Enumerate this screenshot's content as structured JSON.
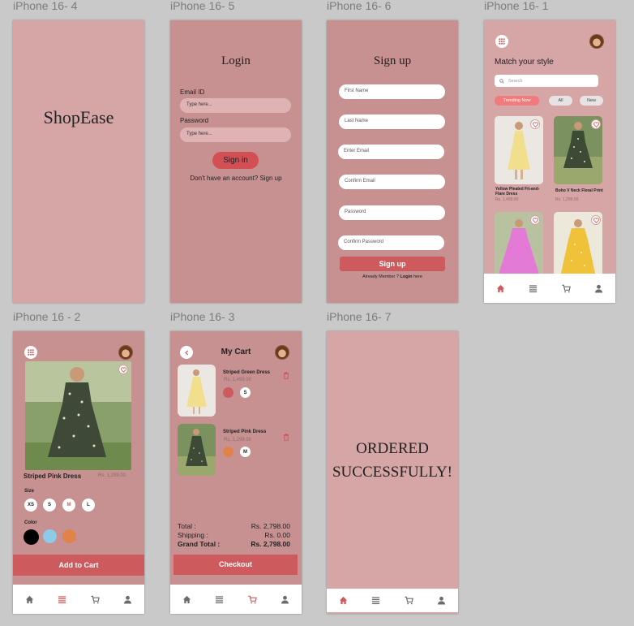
{
  "frames": {
    "f4": {
      "label": "iPhone 16- 4",
      "brand": "ShopEase"
    },
    "f5": {
      "label": "iPhone 16- 5",
      "title": "Login",
      "email_label": "Email ID",
      "email_placeholder": "Type here...",
      "password_label": "Password",
      "password_placeholder": "Type here...",
      "signin": "Sign in",
      "signup_prompt": "Don't have an account? Sign up"
    },
    "f6": {
      "label": "iPhone 16- 6",
      "title": "Sign up",
      "fields": [
        "First Name",
        "Last Name",
        "Enter Email",
        "Confirm Email",
        "Password",
        "Confirm Password"
      ],
      "signup_button": "Sign up",
      "login_prompt_pre": "Already Member ? ",
      "login_prompt_link": "Login",
      "login_prompt_post": " here"
    },
    "f1": {
      "label": "iPhone 16- 1",
      "heading": "Match your style",
      "search_placeholder": "Search",
      "chips": [
        "Trending Now",
        "All",
        "New"
      ],
      "products": [
        {
          "name": "Yellow Pleated Fit-and-Flare Dress",
          "price": "Rs. 1,499.00"
        },
        {
          "name": "Boho V Neck Floral Print",
          "price": "Rs. 1,299.00"
        }
      ]
    },
    "f2": {
      "label": "iPhone 16 - 2",
      "product_name": "Striped Pink Dress",
      "price": "Rs. 1,299.00",
      "size_label": "Size",
      "sizes": [
        "XS",
        "S",
        "M",
        "L"
      ],
      "color_label": "Color",
      "add_to_cart": "Add to Cart"
    },
    "f3": {
      "label": "iPhone 16- 3",
      "title": "My Cart",
      "items": [
        {
          "name": "Striped Green Dress",
          "price": "Rs. 1,499.00",
          "size": "S"
        },
        {
          "name": "Striped Pink Dress",
          "price": "Rs. 1,299.00",
          "size": "M"
        }
      ],
      "total_label": "Total :",
      "total": "Rs. 2,798.00",
      "shipping_label": "Shipping :",
      "shipping": "Rs. 0.00",
      "grand_label": "Grand Total :",
      "grand_total": "Rs. 2,798.00",
      "checkout": "Checkout"
    },
    "f7": {
      "label": "iPhone 16- 7",
      "line1": "ORDERED",
      "line2": "SUCCESSFULLY!"
    }
  },
  "colors": {
    "accent": "#cd5a5d",
    "bg_light": "#d6a5a6",
    "bg_dark": "#c79091",
    "canvas": "#c9c9c9"
  },
  "icons": [
    "home-icon",
    "list-icon",
    "cart-icon",
    "user-icon",
    "grid-icon",
    "search-icon",
    "heart-icon",
    "trash-icon",
    "back-icon"
  ]
}
